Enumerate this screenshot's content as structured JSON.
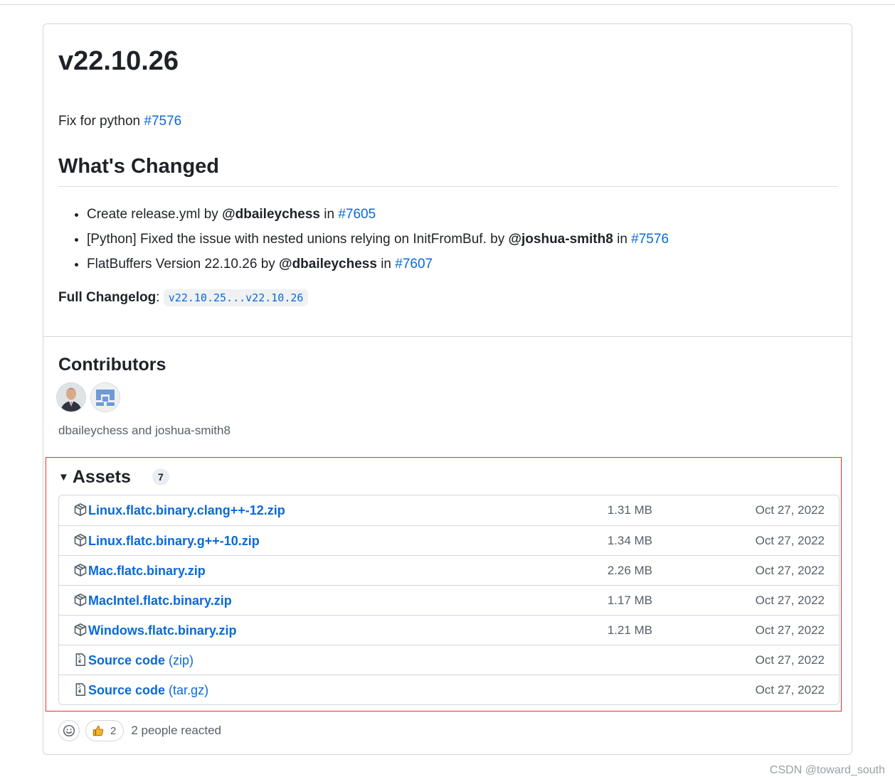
{
  "release": {
    "title": "v22.10.26",
    "intro": {
      "text": "Fix for python ",
      "link": "#7576"
    },
    "whats_changed_heading": "What's Changed",
    "changes": [
      {
        "text": "Create release.yml by ",
        "author": "@dbaileychess",
        "in": " in ",
        "pr": "#7605"
      },
      {
        "text": "[Python] Fixed the issue with nested unions relying on InitFromBuf. by ",
        "author": "@joshua-smith8",
        "in": " in ",
        "pr": "#7576"
      },
      {
        "text": "FlatBuffers Version 22.10.26 by ",
        "author": "@dbaileychess",
        "in": " in ",
        "pr": "#7607"
      }
    ],
    "changelog": {
      "label": "Full Changelog",
      "sep": ": ",
      "value": "v22.10.25...v22.10.26"
    }
  },
  "contributors": {
    "heading": "Contributors",
    "names": "dbaileychess and joshua-smith8",
    "avatars": [
      "dbaileychess",
      "joshua-smith8"
    ]
  },
  "assets": {
    "heading": "Assets",
    "count": "7",
    "items": [
      {
        "icon": "package-icon",
        "name": "Linux.flatc.binary.clang++-12.zip",
        "sub": "",
        "size": "1.31 MB",
        "date": "Oct 27, 2022"
      },
      {
        "icon": "package-icon",
        "name": "Linux.flatc.binary.g++-10.zip",
        "sub": "",
        "size": "1.34 MB",
        "date": "Oct 27, 2022"
      },
      {
        "icon": "package-icon",
        "name": "Mac.flatc.binary.zip",
        "sub": "",
        "size": "2.26 MB",
        "date": "Oct 27, 2022"
      },
      {
        "icon": "package-icon",
        "name": "MacIntel.flatc.binary.zip",
        "sub": "",
        "size": "1.17 MB",
        "date": "Oct 27, 2022"
      },
      {
        "icon": "package-icon",
        "name": "Windows.flatc.binary.zip",
        "sub": "",
        "size": "1.21 MB",
        "date": "Oct 27, 2022"
      },
      {
        "icon": "file-zip-icon",
        "name": "Source code",
        "sub": " (zip)",
        "size": "",
        "date": "Oct 27, 2022"
      },
      {
        "icon": "file-zip-icon",
        "name": "Source code",
        "sub": " (tar.gz)",
        "size": "",
        "date": "Oct 27, 2022"
      }
    ]
  },
  "reactions": {
    "thumbs_count": "2",
    "text": "2 people reacted"
  },
  "watermark": "CSDN @toward_south",
  "colors": {
    "link": "#0969da",
    "highlight_border": "#e0332e",
    "border": "#d0d7de"
  }
}
